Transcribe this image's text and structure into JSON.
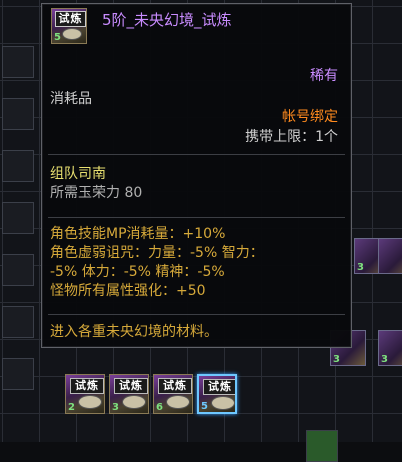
{
  "tooltip": {
    "name": "5阶_未央幻境_试炼",
    "icon": {
      "tag": "试炼",
      "stack": "5",
      "name": "trial-scroll-icon"
    },
    "rarity": "稀有",
    "type": "消耗品",
    "bind": "帐号绑定",
    "carry_limit": "携带上限：1个",
    "party": "组队司南",
    "fatigue": "所需玉荣力 80",
    "effects": [
      "角色技能MP消耗量：+10%",
      "角色虚弱诅咒：力量：-5% 智力：",
      "-5% 体力：-5% 精神：-5%",
      "怪物所有属性强化：+50"
    ],
    "description": "进入各重未央幻境的材料。"
  },
  "inventory": {
    "items": [
      {
        "tag": "试炼",
        "stack": "2",
        "stack_color": "#7ee07e"
      },
      {
        "tag": "试炼",
        "stack": "3",
        "stack_color": "#7ee07e"
      },
      {
        "tag": "试炼",
        "stack": "6",
        "stack_color": "#7ee07e"
      },
      {
        "tag": "试炼",
        "stack": "5",
        "stack_color": "#6ec8ff"
      }
    ],
    "side_stacks": [
      "3",
      "3",
      "3"
    ]
  },
  "colors": {
    "name": "#c98cff",
    "bind": "#ff8a1e",
    "effect": "#d6a93a",
    "party": "#e8e070"
  }
}
